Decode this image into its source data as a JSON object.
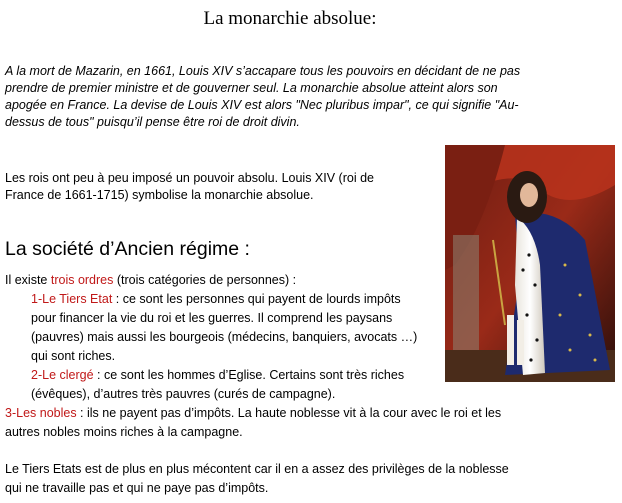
{
  "title": "La monarchie absolue:",
  "intro": {
    "lines": [
      "A la mort de Mazarin, en 1661, Louis XIV s’accapare tous les pouvoirs en décidant de ne pas",
      "prendre de premier ministre et de gouverner seul. La monarchie absolue atteint alors son",
      "apogée en France. La devise de Louis XIV est alors \"Nec pluribus impar\", ce qui signifie \"Au-",
      "dessus de tous\" puisqu’il pense être roi de droit divin."
    ]
  },
  "kings": {
    "lines": [
      "Les rois ont peu à peu imposé un pouvoir absolu. Louis XIV (roi de",
      "France de 1661-1715) symbolise la monarchie absolue."
    ]
  },
  "section": {
    "heading": "La société d’Ancien régime :",
    "intro_before": "Il existe ",
    "intro_red": "trois ordres",
    "intro_after": " (trois catégories de personnes) :",
    "order1": {
      "label": "1-Le Tiers Etat",
      "line1_rest": " : ce sont les personnes qui payent de lourds impôts",
      "lines": [
        "pour financer la vie du roi et les guerres. Il comprend les paysans",
        "(pauvres) mais aussi les bourgeois (médecins, banquiers, avocats …)",
        "qui sont riches."
      ]
    },
    "order2": {
      "label": "2-Le clergé",
      "line1_rest": " : ce sont les hommes d’Eglise. Certains sont très riches",
      "lines": [
        "(évêques), d’autres très pauvres (curés de campagne)."
      ]
    },
    "order3": {
      "label": "3-Les nobles",
      "line1_rest": " : ils ne payent pas d’impôts. La haute noblesse vit à la cour avec le roi et les",
      "lines": [
        "autres nobles moins riches à la campagne."
      ]
    }
  },
  "conclusion": {
    "lines": [
      "Le Tiers Etats est de plus en plus mécontent car il en a assez des privilèges de la noblesse",
      "qui ne travaille pas et qui ne paye pas d’impôts."
    ]
  },
  "colors": {
    "highlight_red": "#c01818"
  }
}
